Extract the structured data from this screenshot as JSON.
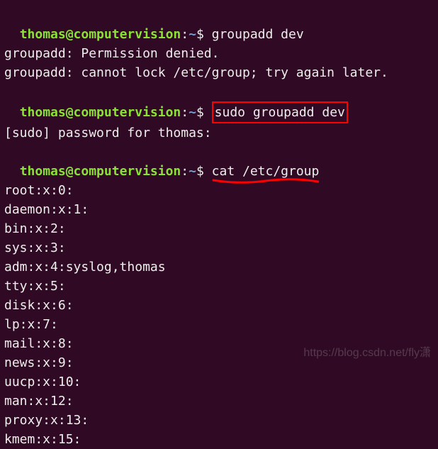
{
  "prompt": {
    "user_host": "thomas@computervision",
    "colon": ":",
    "path": "~",
    "dollar": "$"
  },
  "lines": {
    "cmd1": " groupadd dev",
    "out1": "groupadd: Permission denied.",
    "out2": "groupadd: cannot lock /etc/group; try again later.",
    "cmd2_pre": " ",
    "cmd2_boxed": "sudo groupadd dev",
    "out3": "[sudo] password for thomas:",
    "cmd3_pre": " ",
    "cmd3_underlined": "cat /etc/group",
    "g0": "root:x:0:",
    "g1": "daemon:x:1:",
    "g2": "bin:x:2:",
    "g3": "sys:x:3:",
    "g4": "adm:x:4:syslog,thomas",
    "g5": "tty:x:5:",
    "g6": "disk:x:6:",
    "g7": "lp:x:7:",
    "g8": "mail:x:8:",
    "g9": "news:x:9:",
    "g10": "uucp:x:10:",
    "g11": "man:x:12:",
    "g12": "proxy:x:13:",
    "g13": "kmem:x:15:"
  },
  "watermark": "https://blog.csdn.net/fly潇"
}
